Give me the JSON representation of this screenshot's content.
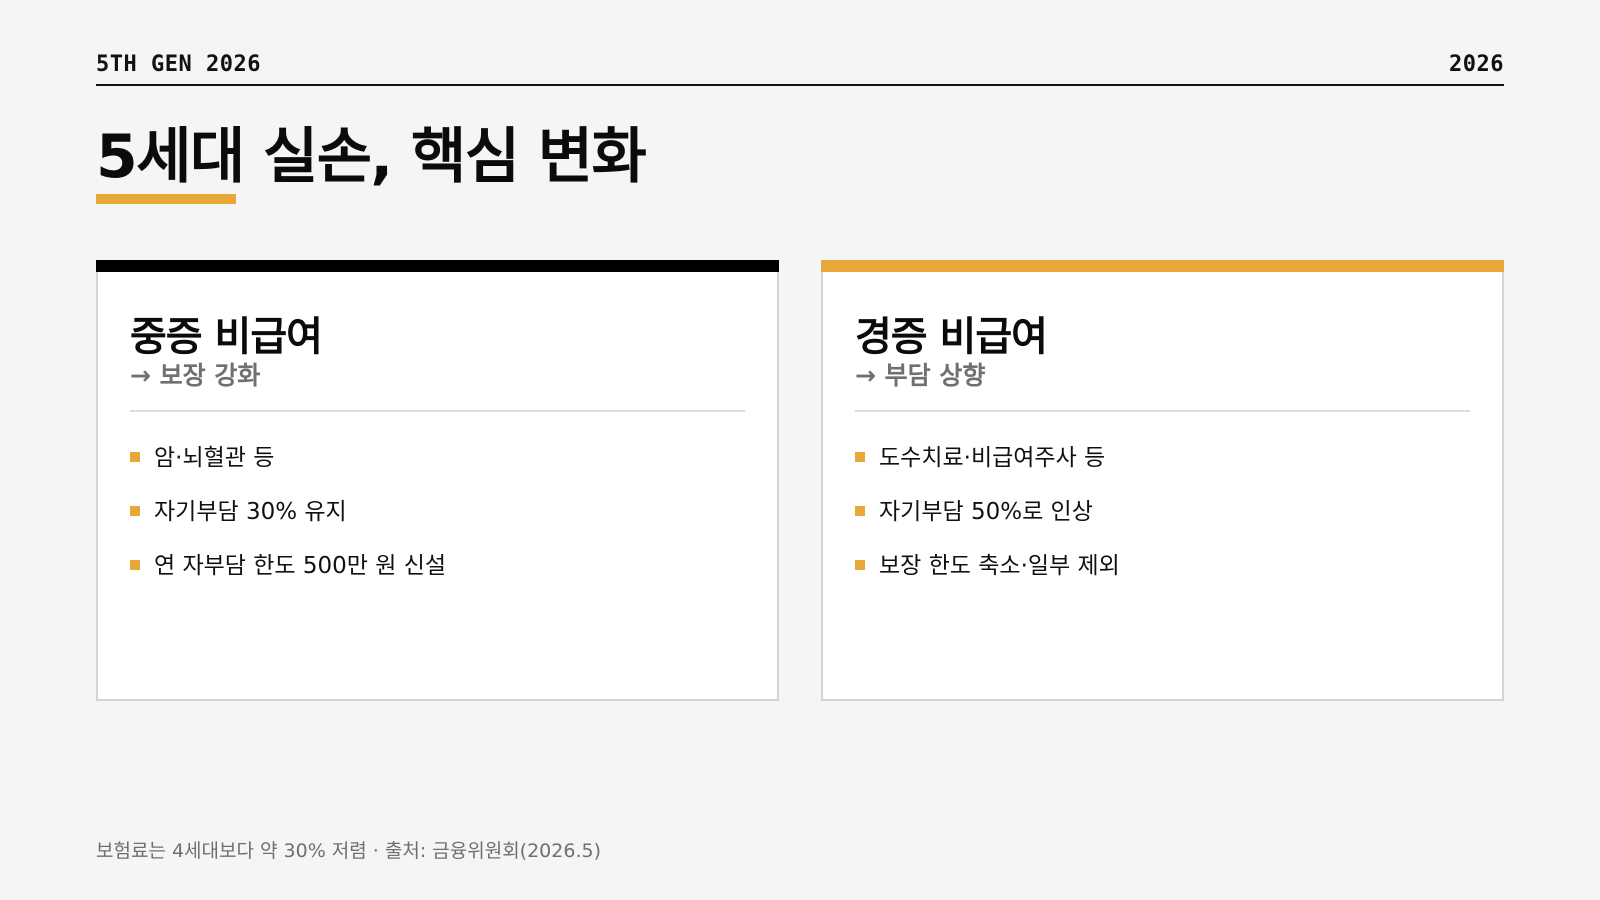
{
  "header": {
    "left": "5TH GEN 2026",
    "right": "2026"
  },
  "title": "5세대 실손, 핵심 변화",
  "cards": [
    {
      "title": "중증 비급여",
      "subtitle": "→ 보장 강화",
      "items": [
        "암·뇌혈관 등",
        "자기부담 30% 유지",
        "연 자부담 한도 500만 원 신설"
      ]
    },
    {
      "title": "경증 비급여",
      "subtitle": "→ 부담 상향",
      "items": [
        "도수치료·비급여주사 등",
        "자기부담 50%로 인상",
        "보장 한도 축소·일부 제외"
      ]
    }
  ],
  "footer": "보험료는 4세대보다 약 30% 저렴 · 출처: 금융위원회(2026.5)",
  "colors": {
    "accent": "#e8a838",
    "dark": "#000000",
    "background": "#f5f5f5"
  }
}
